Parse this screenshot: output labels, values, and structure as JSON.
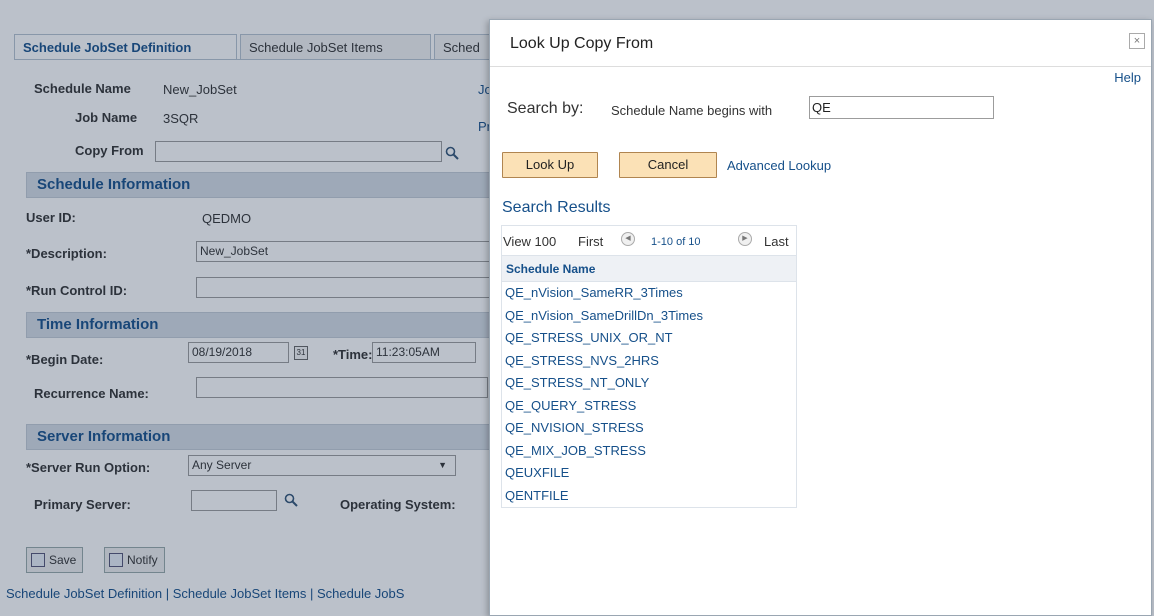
{
  "tabs": [
    {
      "label": "Schedule JobSet Definition",
      "active": true
    },
    {
      "label": "Schedule JobSet Items",
      "active": false
    },
    {
      "label": "Sched",
      "active": false
    }
  ],
  "header": {
    "schedule_name_label": "Schedule Name",
    "schedule_name_value": "New_JobSet",
    "job_name_label": "Job Name",
    "job_name_value": "3SQR",
    "copy_from_label": "Copy From",
    "copy_from_value": "",
    "right_link_1": "Jo",
    "right_link_2": "Pr"
  },
  "schedule_info": {
    "heading": "Schedule Information",
    "user_id_label": "User ID:",
    "user_id_value": "QEDMO",
    "description_label": "*Description:",
    "description_value": "New_JobSet",
    "run_control_label": "*Run Control ID:",
    "run_control_value": ""
  },
  "time_info": {
    "heading": "Time Information",
    "begin_date_label": "*Begin Date:",
    "begin_date_value": "08/19/2018",
    "calendar_glyph": "31",
    "time_label": "*Time:",
    "time_value": "11:23:05AM",
    "recurrence_label": "Recurrence Name:",
    "recurrence_value": ""
  },
  "server_info": {
    "heading": "Server Information",
    "run_option_label": "*Server Run Option:",
    "run_option_value": "Any Server",
    "primary_server_label": "Primary Server:",
    "primary_server_value": "",
    "os_label": "Operating System:"
  },
  "actions": {
    "save_label": "Save",
    "notify_label": "Notify"
  },
  "footer_links": "Schedule JobSet Definition | Schedule JobSet Items | Schedule JobS",
  "modal": {
    "title": "Look Up Copy From",
    "close_glyph": "×",
    "help_label": "Help",
    "search_by_label": "Search by:",
    "condition_label": "Schedule Name begins with",
    "search_value": "QE",
    "lookup_label": "Look Up",
    "cancel_label": "Cancel",
    "advanced_label": "Advanced Lookup",
    "results_heading": "Search Results",
    "nav": {
      "view": "View 100",
      "first": "First",
      "range": "1-10 of 10",
      "last": "Last"
    },
    "column_header": "Schedule Name",
    "results": [
      "QE_nVision_SameRR_3Times",
      "QE_nVision_SameDrillDn_3Times",
      "QE_STRESS_UNIX_OR_NT",
      "QE_STRESS_NVS_2HRS",
      "QE_STRESS_NT_ONLY",
      "QE_QUERY_STRESS",
      "QE_NVISION_STRESS",
      "QE_MIX_JOB_STRESS",
      "QEUXFILE",
      "QENTFILE"
    ]
  },
  "colors": {
    "link_blue": "#16508a",
    "section_bg": "#d6dde6",
    "button_orange": "#fbe1b6",
    "overlay": "rgba(30,50,80,0.30)"
  }
}
